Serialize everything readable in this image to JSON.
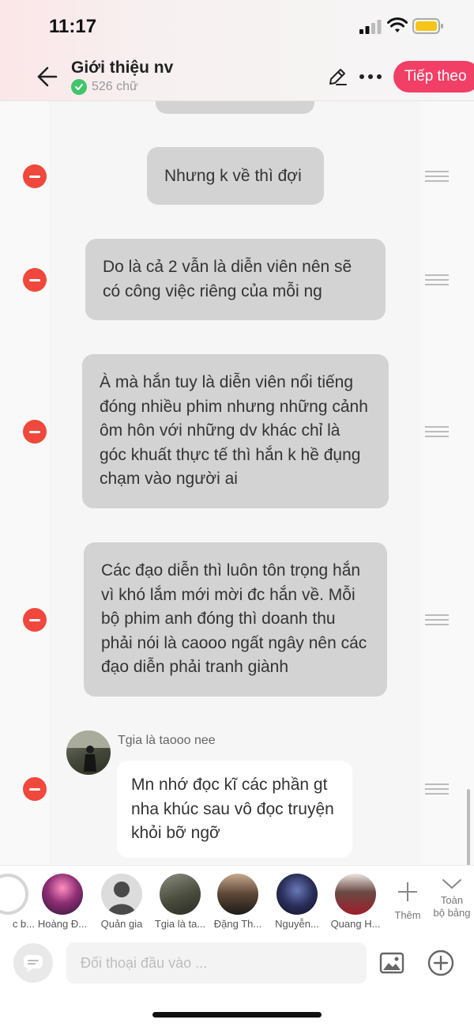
{
  "status": {
    "time": "11:17"
  },
  "header": {
    "title": "Giới thiệu nv",
    "word_count": "526 chữ",
    "next_label": "Tiếp theo",
    "accent": "#f23f66"
  },
  "messages": [
    {
      "text": "Nhưng k về thì đợi"
    },
    {
      "text": "Do là cả 2 vẫn là diễn viên nên sẽ có công việc riêng của mỗi ng"
    },
    {
      "text": "À mà hắn tuy là diễn viên nổi tiếng đóng nhiều phim nhưng những cảnh ôm hôn với những dv khác chỉ là góc khuất thực tế thì hắn k hề đụng chạm vào người ai"
    },
    {
      "text": "Các đạo diễn thì luôn tôn trọng hắn vì khó lắm mới mời đc hắn về. Mỗi bộ phim anh đóng thì doanh thu phải nói là caooo ngất ngây nên các đạo diễn phải tranh giành"
    },
    {
      "sender": "Tgia là taooo nee",
      "text": "Mn nhớ đọc kĩ các phần gt nha khúc sau vô đọc truyện khỏi bỡ ngỡ"
    }
  ],
  "characters": [
    {
      "name": "c b..."
    },
    {
      "name": "Hoàng Đ..."
    },
    {
      "name": "Quản gia"
    },
    {
      "name": "Tgia là ta..."
    },
    {
      "name": "Đặng Th..."
    },
    {
      "name": "Nguyễn..."
    },
    {
      "name": "Quang H..."
    }
  ],
  "tools": {
    "add_label": "Thêm",
    "full_label_1": "Toàn",
    "full_label_2": "bộ bảng"
  },
  "input": {
    "placeholder": "Đối thoại đầu vào ..."
  }
}
